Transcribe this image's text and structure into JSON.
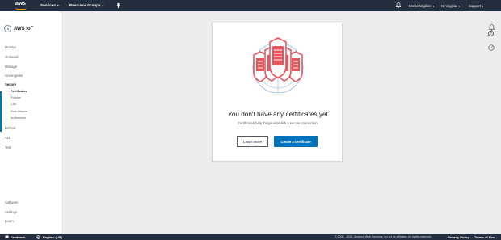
{
  "topbar": {
    "logo_text": "aws",
    "services": "Services",
    "resource_groups": "Resource Groups",
    "user": "Enrico Migliore",
    "region": "N. Virginia",
    "support": "Support",
    "caret": "▾"
  },
  "sidebar": {
    "brand": "AWS IoT",
    "items": {
      "monitor": "Monitor",
      "onboard": "Onboard",
      "manage": "Manage",
      "greengrass": "Greengrass",
      "secure": "Secure",
      "certificates": "Certificates",
      "policies": "Policies",
      "cas": "CAs",
      "role_aliases": "Role Aliases",
      "authorizers": "Authorizers",
      "defend": "Defend",
      "act": "Act",
      "test": "Test",
      "software": "Software",
      "settings": "Settings",
      "learn": "Learn"
    }
  },
  "main": {
    "headline": "You don't have any certificates yet",
    "subline": "Certificates help things establish a secure connection.",
    "learn_more": "Learn more",
    "create": "Create a certificate"
  },
  "footer": {
    "feedback": "Feedback",
    "language": "English (US)",
    "copyright": "© 2008 - 2020, Amazon Web Services, Inc. or its affiliates. All rights reserved.",
    "privacy": "Privacy Policy",
    "terms": "Terms of Use"
  },
  "colors": {
    "topbar": "#232f3e",
    "accent": "#0073bb",
    "shield": "#e8555b",
    "brand_orange": "#ff9900"
  }
}
